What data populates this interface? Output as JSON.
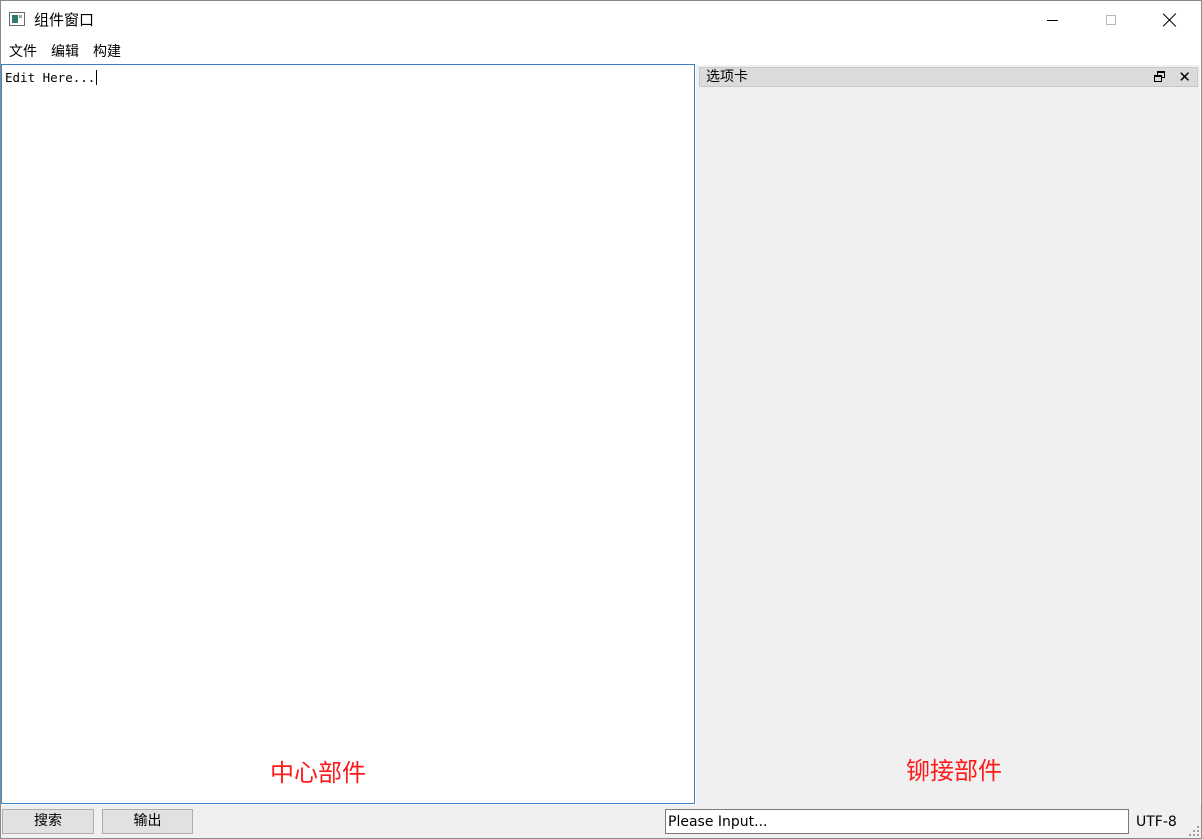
{
  "window": {
    "title": "组件窗口"
  },
  "menu": {
    "items": [
      "文件",
      "编辑",
      "构建"
    ]
  },
  "editor": {
    "text": "Edit Here...",
    "label": "中心部件"
  },
  "dock": {
    "title": "选项卡",
    "close_glyph": "✕",
    "label": "铆接部件"
  },
  "statusbar": {
    "search_label": "搜索",
    "output_label": "输出",
    "input_placeholder": "Please Input...",
    "encoding": "UTF-8"
  },
  "colors": {
    "annotation": "#ff1a1a",
    "editor_border": "#3b83c6",
    "dock_background": "#f0f0f0"
  }
}
